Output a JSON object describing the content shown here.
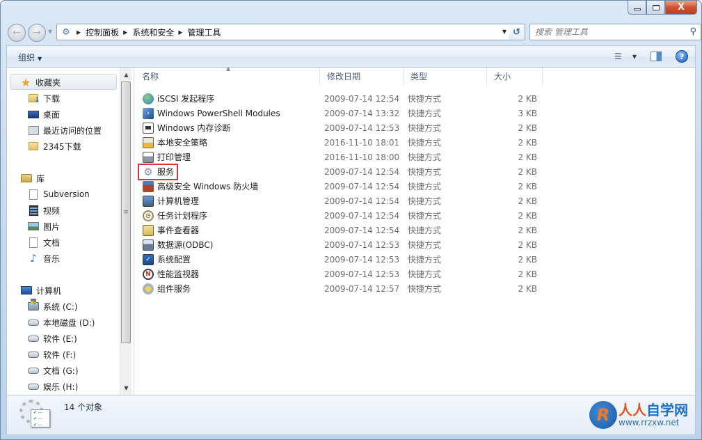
{
  "window": {
    "caption": {
      "minimize": "—",
      "maximize": "□",
      "close": "X"
    }
  },
  "nav": {
    "back_icon": "back-arrow-icon",
    "forward_icon": "forward-arrow-icon",
    "breadcrumb": [
      "控制面板",
      "系统和安全",
      "管理工具"
    ],
    "search_placeholder": "搜索 管理工具"
  },
  "toolbar": {
    "organize_label": "组织",
    "organize_caret": "▼",
    "view_caret": "▼",
    "help_label": "?"
  },
  "sidebar": {
    "favorites": {
      "label": "收藏夹",
      "items": [
        {
          "label": "下载",
          "icon": "download-folder-icon"
        },
        {
          "label": "桌面",
          "icon": "desktop-icon"
        },
        {
          "label": "最近访问的位置",
          "icon": "recent-places-icon"
        },
        {
          "label": "2345下载",
          "icon": "folder-icon"
        }
      ]
    },
    "libraries": {
      "label": "库",
      "items": [
        {
          "label": "Subversion",
          "icon": "document-library-icon"
        },
        {
          "label": "视频",
          "icon": "video-icon"
        },
        {
          "label": "图片",
          "icon": "pictures-icon"
        },
        {
          "label": "文档",
          "icon": "documents-icon"
        },
        {
          "label": "音乐",
          "icon": "music-icon"
        }
      ]
    },
    "computer": {
      "label": "计算机",
      "items": [
        {
          "label": "系统 (C:)",
          "icon": "system-drive-icon"
        },
        {
          "label": "本地磁盘 (D:)",
          "icon": "drive-icon"
        },
        {
          "label": "软件 (E:)",
          "icon": "drive-icon"
        },
        {
          "label": "软件 (F:)",
          "icon": "drive-icon"
        },
        {
          "label": "文档 (G:)",
          "icon": "drive-icon"
        },
        {
          "label": "娱乐 (H:)",
          "icon": "drive-icon"
        }
      ]
    }
  },
  "filelist": {
    "columns": {
      "name": "名称",
      "modified": "修改日期",
      "type": "类型",
      "size": "大小"
    },
    "highlighted_item": "服务",
    "rows": [
      {
        "name": "iSCSI 发起程序",
        "modified": "2009-07-14 12:54",
        "type": "快捷方式",
        "size": "2 KB",
        "icon": "iscsi-icon"
      },
      {
        "name": "Windows PowerShell Modules",
        "modified": "2009-07-14 13:32",
        "type": "快捷方式",
        "size": "3 KB",
        "icon": "powershell-icon"
      },
      {
        "name": "Windows 内存诊断",
        "modified": "2009-07-14 12:53",
        "type": "快捷方式",
        "size": "2 KB",
        "icon": "memory-diagnostic-icon"
      },
      {
        "name": "本地安全策略",
        "modified": "2016-11-10 18:01",
        "type": "快捷方式",
        "size": "2 KB",
        "icon": "security-policy-icon"
      },
      {
        "name": "打印管理",
        "modified": "2016-11-10 18:00",
        "type": "快捷方式",
        "size": "2 KB",
        "icon": "printer-icon"
      },
      {
        "name": "服务",
        "modified": "2009-07-14 12:54",
        "type": "快捷方式",
        "size": "2 KB",
        "icon": "services-gear-icon"
      },
      {
        "name": "高级安全 Windows 防火墙",
        "modified": "2009-07-14 12:54",
        "type": "快捷方式",
        "size": "2 KB",
        "icon": "firewall-icon"
      },
      {
        "name": "计算机管理",
        "modified": "2009-07-14 12:54",
        "type": "快捷方式",
        "size": "2 KB",
        "icon": "computer-management-icon"
      },
      {
        "name": "任务计划程序",
        "modified": "2009-07-14 12:54",
        "type": "快捷方式",
        "size": "2 KB",
        "icon": "task-scheduler-icon"
      },
      {
        "name": "事件查看器",
        "modified": "2009-07-14 12:54",
        "type": "快捷方式",
        "size": "2 KB",
        "icon": "event-viewer-icon"
      },
      {
        "name": "数据源(ODBC)",
        "modified": "2009-07-14 12:53",
        "type": "快捷方式",
        "size": "2 KB",
        "icon": "odbc-icon"
      },
      {
        "name": "系统配置",
        "modified": "2009-07-14 12:53",
        "type": "快捷方式",
        "size": "2 KB",
        "icon": "system-config-icon"
      },
      {
        "name": "性能监视器",
        "modified": "2009-07-14 12:53",
        "type": "快捷方式",
        "size": "2 KB",
        "icon": "performance-monitor-icon"
      },
      {
        "name": "组件服务",
        "modified": "2009-07-14 12:57",
        "type": "快捷方式",
        "size": "2 KB",
        "icon": "component-services-icon"
      }
    ]
  },
  "status": {
    "count_text": "14 个对象"
  },
  "watermark": {
    "brand_part1": "人人",
    "brand_part2": "自学网",
    "url": "www.rrzxw.net",
    "logo_letter": "R"
  },
  "colors": {
    "highlight": "#d9343a",
    "accent": "#1d6fc6"
  }
}
